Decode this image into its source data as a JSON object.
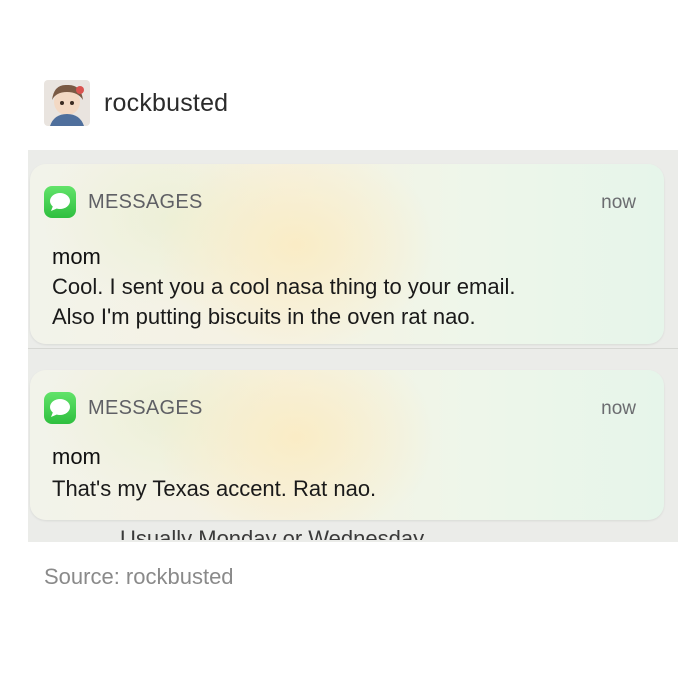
{
  "post": {
    "username": "rockbusted",
    "avatar": "avatar-icon"
  },
  "notifications": [
    {
      "app_icon": "messages-icon",
      "app_name": "MESSAGES",
      "time": "now",
      "sender": "mom",
      "lines": [
        "Cool. I sent you a cool nasa thing to your email.",
        "Also I'm putting biscuits in the oven rat nao."
      ]
    },
    {
      "app_icon": "messages-icon",
      "app_name": "MESSAGES",
      "time": "now",
      "sender": "mom",
      "lines": [
        "That's my Texas accent. Rat nao."
      ]
    }
  ],
  "behind_text": "Usually Monday or Wednesday",
  "caption": "Source: rockbusted",
  "colors": {
    "messages_green": "#34c759",
    "source_gray": "#8a8a8a"
  }
}
